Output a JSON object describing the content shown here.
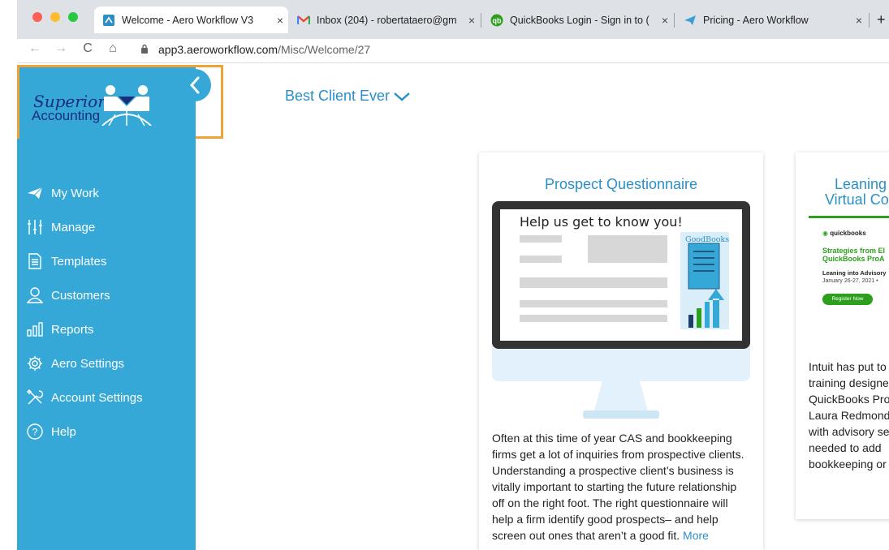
{
  "browser": {
    "tabs": [
      {
        "label": "Welcome - Aero Workflow V3",
        "icon": "aero-workflow-icon"
      },
      {
        "label": "Inbox (204) - robertataero@gm",
        "icon": "gmail-icon"
      },
      {
        "label": "QuickBooks Login - Sign in to (",
        "icon": "quickbooks-icon"
      },
      {
        "label": "Pricing - Aero Workflow",
        "icon": "aero-plane-icon"
      }
    ],
    "url_domain": "app3.aeroworkflow.com",
    "url_path": "/Misc/Welcome/27"
  },
  "logo": {
    "line1": "Superior",
    "line2": "Accounting"
  },
  "client_selector": "Best Client Ever",
  "sidebar": {
    "items": [
      {
        "label": "My Work",
        "icon": "paper-plane-icon"
      },
      {
        "label": "Manage",
        "icon": "sliders-icon"
      },
      {
        "label": "Templates",
        "icon": "document-icon"
      },
      {
        "label": "Customers",
        "icon": "user-icon"
      },
      {
        "label": "Reports",
        "icon": "bar-chart-icon"
      },
      {
        "label": "Aero Settings",
        "icon": "gear-icon"
      },
      {
        "label": "Account Settings",
        "icon": "tools-icon"
      },
      {
        "label": "Help",
        "icon": "help-icon"
      }
    ]
  },
  "cards": [
    {
      "title": "Prospect Questionnaire",
      "illustration_heading": "Help us get to know you!",
      "illustration_badge": "GoodBooks",
      "text": "Often at this time of year CAS and bookkeeping firms get a lot of inquiries from prospective clients. Understanding a prospective client’s business is vitally important to starting the future relationship off on the right foot. The right questionnaire will help a firm identify good prospects– and help screen out ones that aren’t a good fit.",
      "more": "More"
    },
    {
      "title_line1": "Leaning",
      "title_line2": "Virtual Co",
      "promo_brand": "quickbooks",
      "promo_title_line1": "Strategies from El",
      "promo_title_line2": "QuickBooks ProA",
      "promo_event": "Leaning into Advisory",
      "promo_date": "January 26-27, 2021  •",
      "promo_button": "Register Now",
      "text_lines": [
        "Intuit has put to",
        "training designe",
        "QuickBooks Pro",
        "Laura Redmond",
        "with advisory se",
        "needed to add",
        "bookkeeping or"
      ]
    }
  ],
  "colors": {
    "sidebar": "#35a8d8",
    "accent": "#2b8fc7",
    "highlight_border": "#f0a335"
  }
}
